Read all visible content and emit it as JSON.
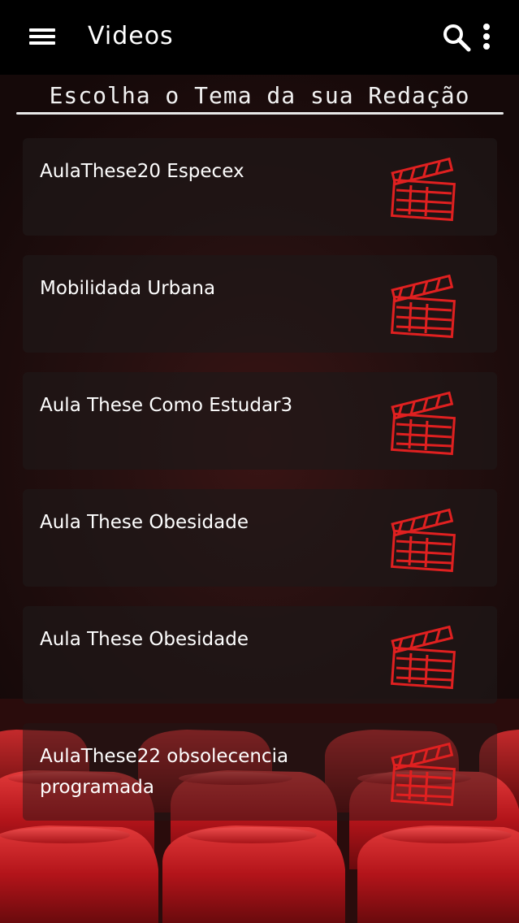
{
  "toolbar": {
    "title": "Videos",
    "menu_icon": "hamburger-menu-icon",
    "search_icon": "search-icon",
    "more_icon": "more-vert-icon"
  },
  "heading": "Escolha o Tema da sua Redação",
  "videos": [
    {
      "title": "AulaThese20 Especex",
      "icon": "clapperboard-icon"
    },
    {
      "title": "Mobilidada Urbana",
      "icon": "clapperboard-icon"
    },
    {
      "title": "Aula These Como Estudar3",
      "icon": "clapperboard-icon"
    },
    {
      "title": "Aula These Obesidade",
      "icon": "clapperboard-icon"
    },
    {
      "title": "Aula These Obesidade",
      "icon": "clapperboard-icon"
    },
    {
      "title": "AulaThese22 obsolecencia programada",
      "icon": "clapperboard-icon"
    }
  ],
  "colors": {
    "toolbar_bg": "#000000",
    "background": "#261010",
    "accent_red": "#e02020",
    "seat_red": "#c8161b"
  }
}
